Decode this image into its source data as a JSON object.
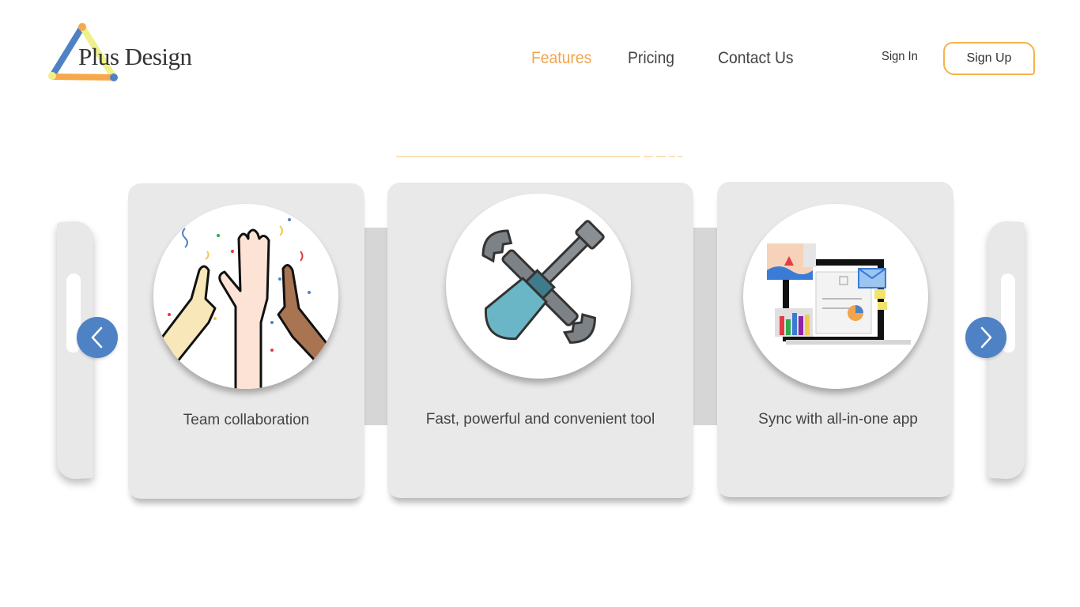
{
  "brand": {
    "name": "Plus Design"
  },
  "nav": {
    "items": [
      {
        "label": "Features",
        "active": true
      },
      {
        "label": "Pricing",
        "active": false
      },
      {
        "label": "Contact Us",
        "active": false
      }
    ]
  },
  "auth": {
    "sign_in": "Sign In",
    "sign_up": "Sign Up"
  },
  "carousel": {
    "cards": [
      {
        "title": "Team collaboration",
        "icon": "high-five-icon"
      },
      {
        "title": "Fast, powerful and convenient tool",
        "icon": "tools-icon"
      },
      {
        "title": "Sync with all-in-one app",
        "icon": "dashboard-icon"
      }
    ],
    "prev_icon": "chevron-left-icon",
    "next_icon": "chevron-right-icon"
  },
  "colors": {
    "accent": "#F2A44B",
    "primary": "#4F82C4",
    "card": "#E9E9E9"
  }
}
